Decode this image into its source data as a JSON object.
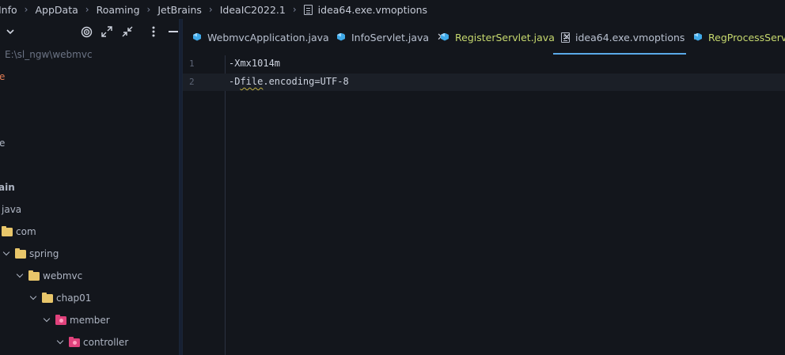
{
  "breadcrumb": [
    {
      "label": "Info"
    },
    {
      "label": "AppData"
    },
    {
      "label": "Roaming"
    },
    {
      "label": "JetBrains"
    },
    {
      "label": "IdeaIC2022.1"
    },
    {
      "label": "idea64.exe.vmoptions",
      "icon": "file-icon"
    }
  ],
  "sidebar": {
    "toolbar_icons": [
      "chevron-down-icon",
      "target-icon",
      "expand-icon",
      "collapse-icon",
      "more-vert-icon",
      "minimize-icon"
    ],
    "project_path": "E:\\sl_ngw\\webmvc",
    "fragments": [
      "e",
      "e",
      "ain",
      "java"
    ],
    "tree": [
      {
        "label": "com",
        "folder": "yellow",
        "expanded": false
      },
      {
        "label": "spring",
        "folder": "yellow",
        "expanded": true
      },
      {
        "label": "webmvc",
        "folder": "yellow",
        "expanded": true
      },
      {
        "label": "chap01",
        "folder": "yellow",
        "expanded": true
      },
      {
        "label": "member",
        "folder": "pink",
        "expanded": true
      },
      {
        "label": "controller",
        "folder": "pink",
        "expanded": true
      }
    ]
  },
  "tabs": [
    {
      "label": "WebmvcApplication.java",
      "icon": "java-class-icon",
      "color": "#b8c0cf",
      "active": false
    },
    {
      "label": "InfoServlet.java",
      "icon": "java-class-icon",
      "color": "#b8c0cf",
      "active": false
    },
    {
      "label": "RegisterServlet.java",
      "icon": "java-class-icon",
      "color": "#c6d86e",
      "active": false
    },
    {
      "label": "idea64.exe.vmoptions",
      "icon": "file-icon",
      "color": "#b8c0cf",
      "active": true
    },
    {
      "label": "RegProcessServlet.java",
      "icon": "java-class-icon",
      "color": "#c6d86e",
      "active": false
    }
  ],
  "editor": {
    "lines": [
      {
        "number": "1",
        "text": "-Xmx1014m"
      },
      {
        "number": "2",
        "prefix": "-D",
        "squiggle": "file",
        "rest": ".encoding=UTF-8"
      }
    ],
    "current_line": 2
  },
  "colors": {
    "background": "#13161c",
    "accent": "#5aa9e8",
    "folder_yellow": "#e8c66a",
    "folder_pink": "#e0427c",
    "modified_tab": "#c6d86e"
  }
}
